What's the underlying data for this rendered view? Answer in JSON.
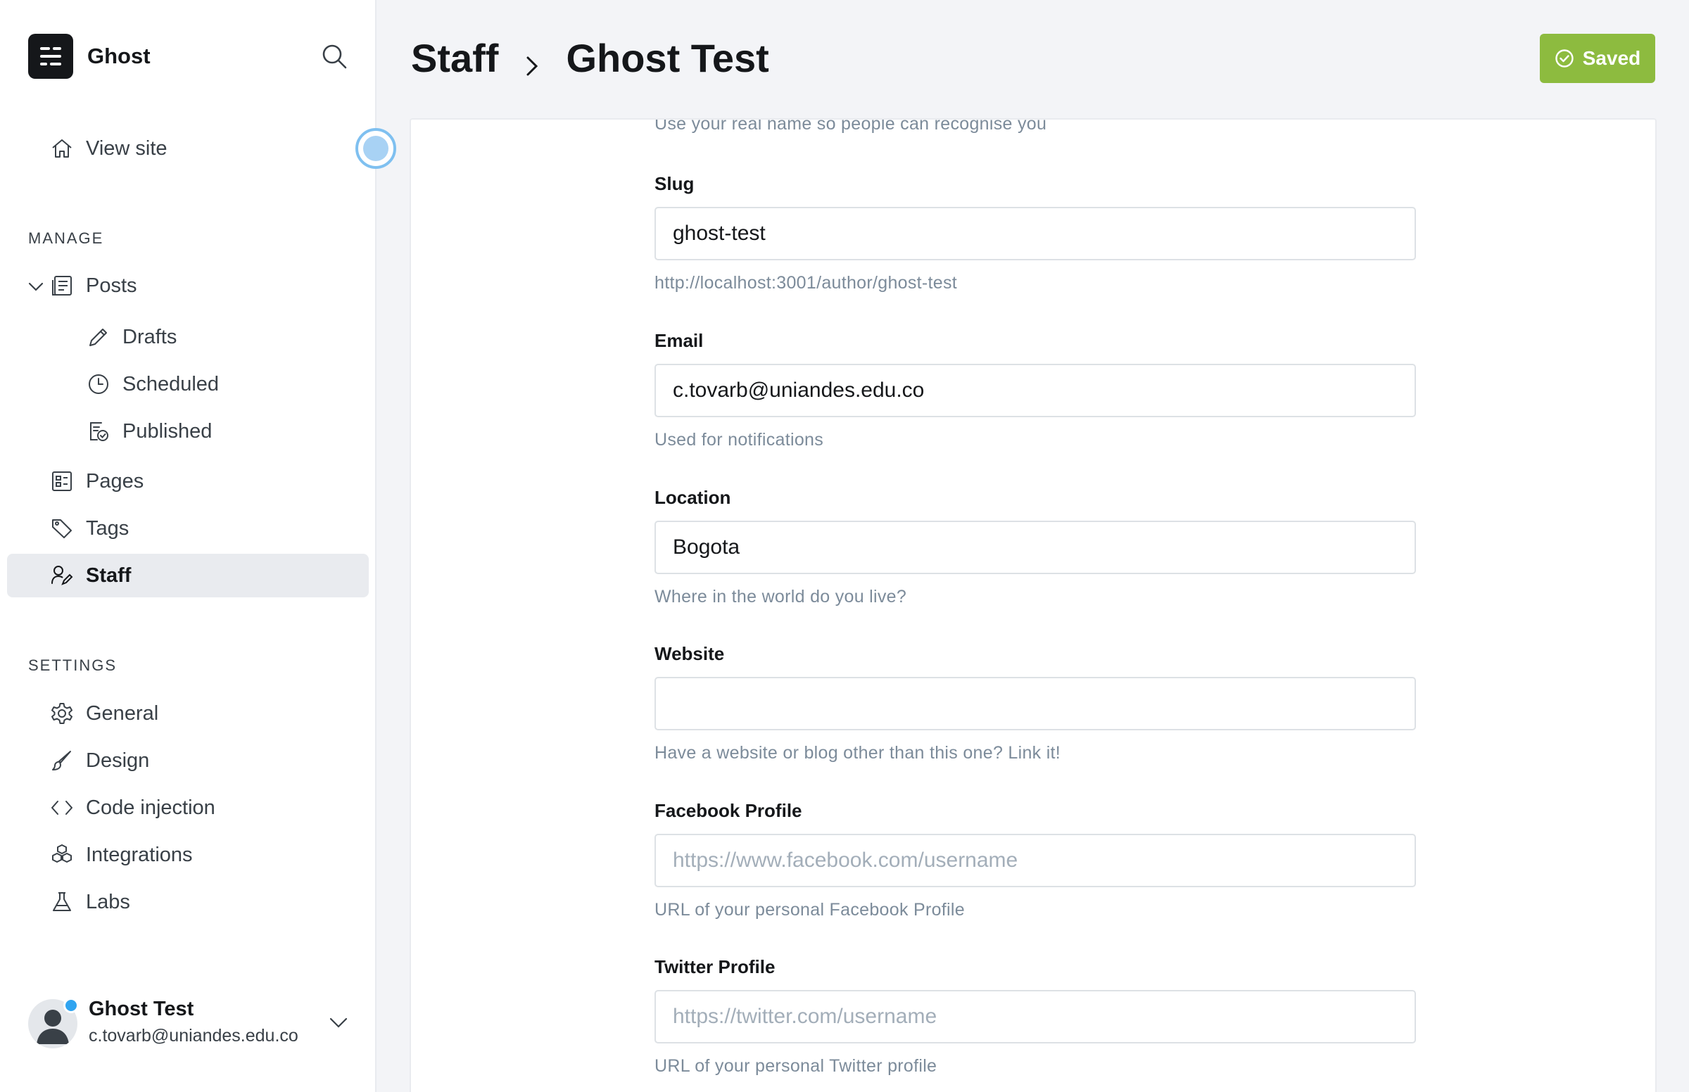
{
  "sidebar": {
    "brand_name": "Ghost",
    "view_site": "View site",
    "manage_title": "MANAGE",
    "posts": "Posts",
    "drafts": "Drafts",
    "scheduled": "Scheduled",
    "published": "Published",
    "pages": "Pages",
    "tags": "Tags",
    "staff": "Staff",
    "settings_title": "SETTINGS",
    "general": "General",
    "design": "Design",
    "code_injection": "Code injection",
    "integrations": "Integrations",
    "labs": "Labs"
  },
  "user": {
    "name": "Ghost Test",
    "email": "c.tovarb@uniandes.edu.co"
  },
  "header": {
    "crumb_parent": "Staff",
    "crumb_current": "Ghost Test",
    "saved_label": "Saved"
  },
  "form": {
    "name_hint": "Use your real name so people can recognise you",
    "slug": {
      "label": "Slug",
      "value": "ghost-test",
      "hint": "http://localhost:3001/author/ghost-test"
    },
    "email": {
      "label": "Email",
      "value": "c.tovarb@uniandes.edu.co",
      "hint": "Used for notifications"
    },
    "location": {
      "label": "Location",
      "value": "Bogota",
      "hint": "Where in the world do you live?"
    },
    "website": {
      "label": "Website",
      "value": "",
      "hint": "Have a website or blog other than this one? Link it!"
    },
    "facebook": {
      "label": "Facebook Profile",
      "value": "",
      "placeholder": "https://www.facebook.com/username",
      "hint": "URL of your personal Facebook Profile"
    },
    "twitter": {
      "label": "Twitter Profile",
      "value": "",
      "placeholder": "https://twitter.com/username",
      "hint": "URL of your personal Twitter profile"
    }
  },
  "colors": {
    "saved_button": "#8dbb3f",
    "notification_dot": "#30a4f0",
    "active_nav_bg": "#e9ebef"
  }
}
